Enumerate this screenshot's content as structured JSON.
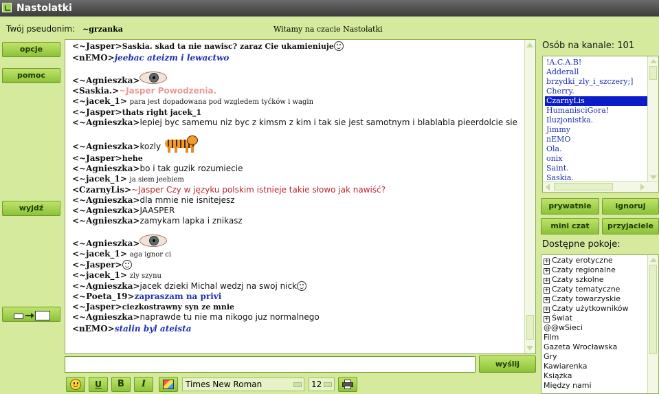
{
  "window": {
    "title": "Nastolatki"
  },
  "header": {
    "nick_label": "Twój pseudonim:",
    "nick_value": "~grzanka",
    "welcome": "Witamy na czacie Nastolatki"
  },
  "left_buttons": {
    "options": "opcje",
    "help": "pomoc",
    "exit": "wyjdź"
  },
  "chat": {
    "messages": [
      {
        "nick": "<~Jasper>",
        "text": "Saskia. skad ta nie nawisc? zaraz Cie ukamieniuje"
      },
      {
        "nick": "<nEMO>",
        "text": "jeebac ateizm i lewactwo"
      },
      {
        "nick": "<~Agnieszka>",
        "text": ""
      },
      {
        "nick": "<Saskia.>",
        "text": "~Jasper Powodzenia."
      },
      {
        "nick": "<~jacek_1>",
        "text": "para jest dopadowana pod wzgledem tyćków i wagin"
      },
      {
        "nick": "<~Jasper>",
        "text": "thats right jacek_1"
      },
      {
        "nick": "<~Agnieszka>",
        "text": "lepiej byc samemu niz byc z kimsm z kim i tak sie jest samotnym i blablabla pieerdolcie sie"
      },
      {
        "nick": "<~Agnieszka>",
        "text": "kozly"
      },
      {
        "nick": "<~Jasper>",
        "text": "hehe"
      },
      {
        "nick": "<~Agnieszka>",
        "text": "bo i tak guzik rozumiecie"
      },
      {
        "nick": "<~jacek_1>",
        "text": "ja siem jeebiem"
      },
      {
        "nick": "<CzarnyLis>",
        "text": "~Jasper Czy w języku polskim istnieje takie słowo jak nawiść?"
      },
      {
        "nick": "<~Agnieszka>",
        "text": "dla mmie nie isnitejesz"
      },
      {
        "nick": "<~Agnieszka>",
        "text": "JAASPER"
      },
      {
        "nick": "<~Agnieszka>",
        "text": "zamykam lapka i znikasz"
      },
      {
        "nick": "<~Agnieszka>",
        "text": ""
      },
      {
        "nick": "<~jacek_1>",
        "text": "aga ignor ci"
      },
      {
        "nick": "<~Jasper>",
        "text": ""
      },
      {
        "nick": "<~jacek_1>",
        "text": "zly szynu"
      },
      {
        "nick": "<~Agnieszka>",
        "text": "jacek dzieki Michal wedzj na swoj nick"
      },
      {
        "nick": "<~Poeta_19>",
        "text": "zapraszam na privi"
      },
      {
        "nick": "<~Jasper>",
        "text": "ciezkostrawny syn ze mnie"
      },
      {
        "nick": "<~Agnieszka>",
        "text": "naprawde tu nie ma nikogo juz normalnego"
      },
      {
        "nick": "<nEMO>",
        "text": "stalin byl ateista"
      }
    ]
  },
  "input": {
    "value": "",
    "send_label": "wyślij"
  },
  "format_toolbar": {
    "underline": "U",
    "bold": "B",
    "italic": "I",
    "font": "Times New Roman",
    "size": "12"
  },
  "users_panel": {
    "label": "Osób na kanale: 101",
    "users": [
      "!A.C.A.B!",
      "Adderall",
      "brzydki_zly_i_szczery;]",
      "Cherry.",
      "CzarnyLis",
      "HumanisciGora!",
      "Iluzjonistka.",
      "Jimmy",
      "nEMO",
      "Ola.",
      "onix",
      "Saint.",
      "Saskia."
    ],
    "selected": "CzarnyLis"
  },
  "user_actions": {
    "private": "prywatnie",
    "ignore": "ignoruj",
    "mini_chat": "mini czat",
    "friends": "przyjaciele"
  },
  "rooms_panel": {
    "label": "Dostępne pokoje:",
    "groups": [
      "Czaty erotyczne",
      "Czaty regionalne",
      "Czaty szkolne",
      "Czaty tematyczne",
      "Czaty towarzyskie",
      "Czaty użytkowników",
      "Świat"
    ],
    "rooms": [
      "@@wSieci",
      "Film",
      "Gazeta Wrocławska",
      "Gry",
      "Kawiarenka",
      "Książka",
      "Między nami"
    ]
  },
  "colors": {
    "background": "#d5ea9c",
    "button": "#a6d44e",
    "selected": "#0a1dc8",
    "nick_link": "#1f2fb0"
  }
}
